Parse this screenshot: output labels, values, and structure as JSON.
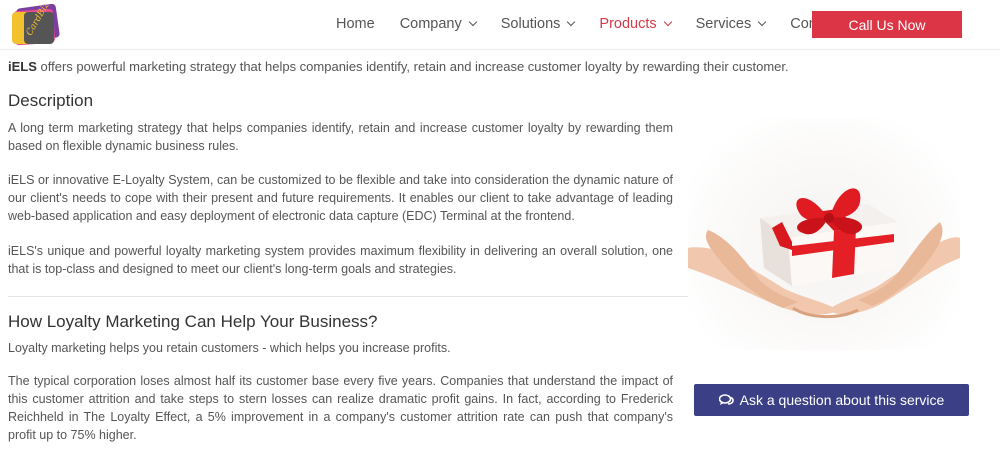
{
  "header": {
    "logo_text": "CardBiz",
    "nav": [
      {
        "label": "Home",
        "has_dropdown": false,
        "active": false
      },
      {
        "label": "Company",
        "has_dropdown": true,
        "active": false
      },
      {
        "label": "Solutions",
        "has_dropdown": true,
        "active": false
      },
      {
        "label": "Products",
        "has_dropdown": true,
        "active": true
      },
      {
        "label": "Services",
        "has_dropdown": true,
        "active": false
      },
      {
        "label": "Contact Us",
        "has_dropdown": false,
        "active": false
      }
    ],
    "cta_label": "Call Us Now"
  },
  "content": {
    "intro_bold": "iELS",
    "intro_rest": " offers powerful marketing strategy that helps companies identify, retain and increase customer loyalty by rewarding their customer.",
    "description_heading": "Description",
    "description_paragraphs": [
      "A long term marketing strategy that helps companies identify, retain and increase customer loyalty by rewarding them based on flexible dynamic business rules.",
      "iELS or innovative E-Loyalty System, can be customized to be flexible and take into consideration the dynamic nature of our client's needs to cope with their present and future requirements. It enables our client to take advantage of leading web-based application and easy deployment of electronic data capture (EDC) Terminal at the frontend.",
      "iELS's unique and powerful loyalty marketing system provides maximum flexibility in delivering an overall solution, one that is top-class and designed to meet our client's long-term goals and strategies."
    ],
    "loyalty_heading": "How Loyalty Marketing Can Help Your Business?",
    "loyalty_paragraphs": [
      "Loyalty marketing helps you retain customers - which helps you increase profits.",
      "The typical corporation loses almost half its customer base every five years. Companies that understand the impact of this customer attrition and take steps to stern losses can realize dramatic profit gains. In fact, according to Frederick Reichheld in The Loyalty Effect, a 5% improvement in a company's customer attrition rate can push that company's profit up to 75% higher."
    ]
  },
  "sidebar": {
    "ask_button_label": "Ask a question about this service",
    "ask_button_icon": "comments-icon"
  },
  "colors": {
    "accent_red": "#dc3545",
    "active_nav": "#d63a49",
    "ask_button_bg": "#3b3f85"
  }
}
